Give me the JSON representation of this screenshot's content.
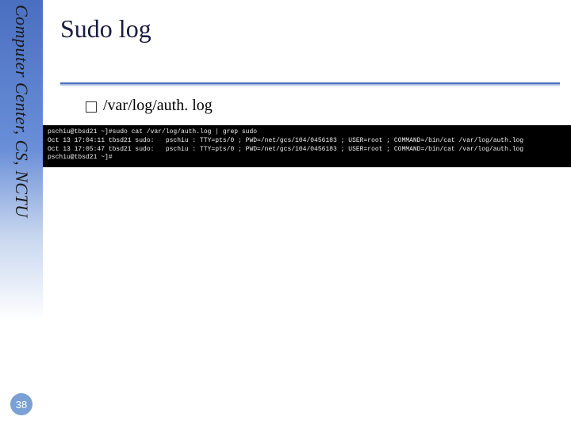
{
  "sidebar": {
    "label": "Computer Center, CS, NCTU"
  },
  "page_number": "38",
  "title": "Sudo log",
  "bullet": {
    "text": "/var/log/auth. log"
  },
  "terminal": {
    "lines": [
      "pschiu@tbsd21 ~]#sudo cat /var/log/auth.log | grep sudo",
      "Oct 13 17:04:11 tbsd21 sudo:   pschiu : TTY=pts/0 ; PWD=/net/gcs/104/0456183 ; USER=root ; COMMAND=/bin/cat /var/log/auth.log",
      "Oct 13 17:05:47 tbsd21 sudo:   pschiu : TTY=pts/0 ; PWD=/net/gcs/104/0456183 ; USER=root ; COMMAND=/bin/cat /var/log/auth.log",
      "pschiu@tbsd21 ~]#"
    ]
  }
}
